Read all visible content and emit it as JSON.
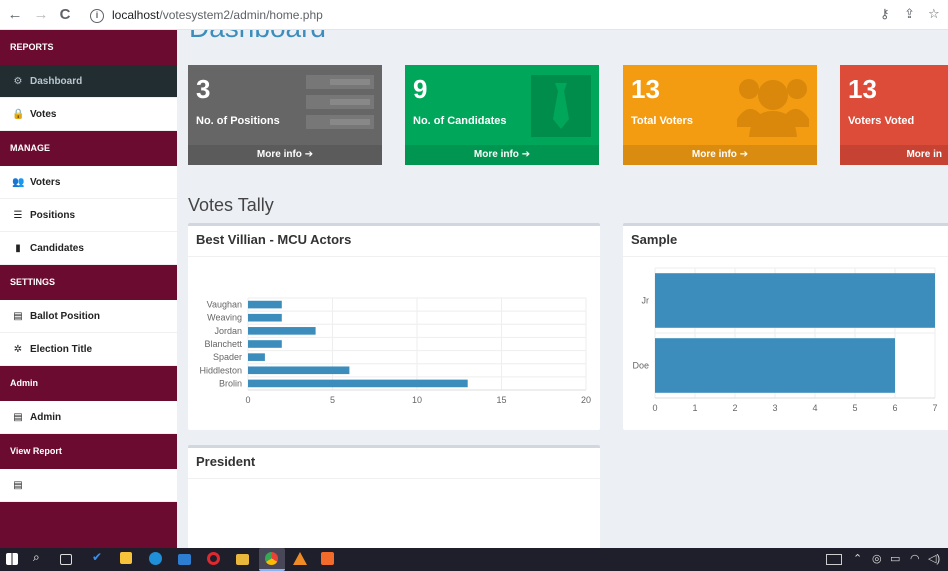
{
  "browser": {
    "url_host": "localhost",
    "url_path": "/votesystem2/admin/home.php",
    "back": "←",
    "forward": "→",
    "reload": "C",
    "info": "i"
  },
  "sidebar": {
    "sections": [
      {
        "header": "REPORTS",
        "items": [
          {
            "label": "Dashboard",
            "icon": "dashboard-icon",
            "glyph": "⚙",
            "active": true
          },
          {
            "label": "Votes",
            "icon": "lock-icon",
            "glyph": "🔒"
          }
        ]
      },
      {
        "header": "MANAGE",
        "items": [
          {
            "label": "Voters",
            "icon": "users-icon",
            "glyph": "👥"
          },
          {
            "label": "Positions",
            "icon": "tasks-icon",
            "glyph": "☰"
          },
          {
            "label": "Candidates",
            "icon": "black-tie-icon",
            "glyph": "▮"
          }
        ]
      },
      {
        "header": "SETTINGS",
        "items": [
          {
            "label": "Ballot Position",
            "icon": "file-icon",
            "glyph": "▤"
          },
          {
            "label": "Election Title",
            "icon": "cog-icon",
            "glyph": "✲"
          }
        ]
      },
      {
        "header": "Admin",
        "items": [
          {
            "label": "Admin",
            "icon": "file-icon",
            "glyph": "▤"
          }
        ]
      },
      {
        "header": "View Report",
        "items": [
          {
            "label": "",
            "icon": "file-icon",
            "glyph": "▤"
          }
        ]
      }
    ]
  },
  "content": {
    "page_title": "Dashboard",
    "section_title": "Votes Tally",
    "stat_boxes": [
      {
        "number": "3",
        "label": "No. of Positions",
        "footer": "More info ➔",
        "color": "#666666",
        "icon": "tasks-icon"
      },
      {
        "number": "9",
        "label": "No. of Candidates",
        "footer": "More info ➔",
        "color": "#00a65a",
        "icon": "black-tie-icon"
      },
      {
        "number": "13",
        "label": "Total Voters",
        "footer": "More info ➔",
        "color": "#f39c12",
        "icon": "users-icon"
      },
      {
        "number": "13",
        "label": "Voters Voted",
        "footer": "More in",
        "color": "#dd4b39",
        "icon": "edit-icon"
      }
    ],
    "panels": {
      "p1_title": "Best Villian - MCU Actors",
      "p2_title": "Sample",
      "p3_title": "President"
    }
  },
  "chart_data": [
    {
      "type": "bar",
      "orientation": "horizontal",
      "title": "Best Villian - MCU Actors",
      "categories": [
        "Vaughan",
        "Weaving",
        "Jordan",
        "Blanchett",
        "Spader",
        "Hiddleston",
        "Brolin"
      ],
      "values": [
        2,
        2,
        4,
        2,
        1,
        6,
        13
      ],
      "xlim": [
        0,
        20
      ],
      "xticks": [
        0,
        5,
        10,
        15,
        20
      ],
      "color": "#3c8dbc"
    },
    {
      "type": "bar",
      "orientation": "horizontal",
      "title": "Sample",
      "categories": [
        "Jr",
        "Doe"
      ],
      "values": [
        7,
        6
      ],
      "xticks": [
        0,
        1,
        2,
        3,
        4,
        5,
        6,
        7
      ],
      "color": "#3c8dbc"
    }
  ]
}
